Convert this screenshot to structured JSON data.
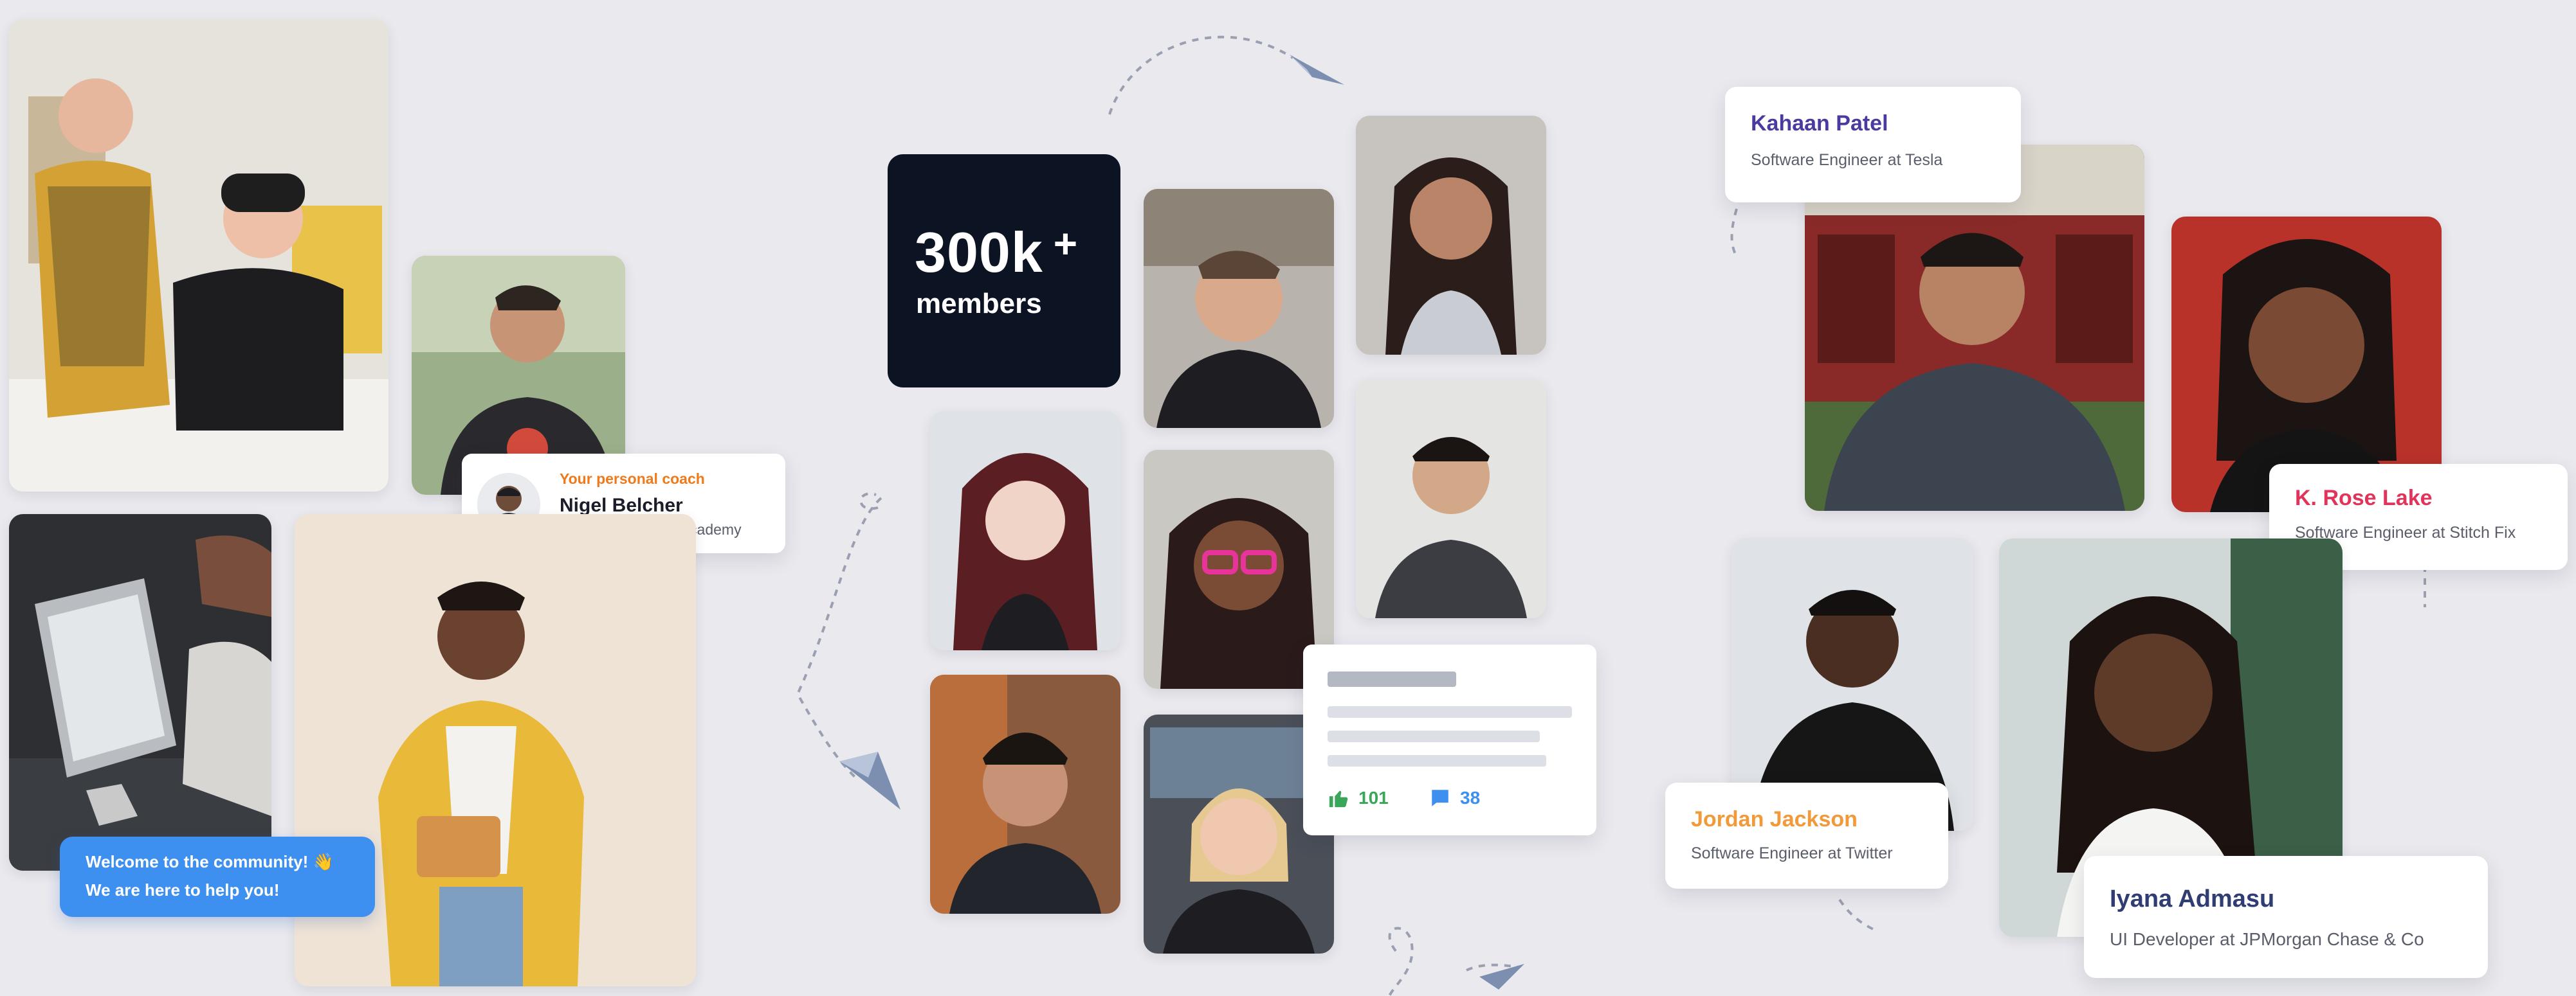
{
  "coach_card": {
    "label": "Your personal coach",
    "name": "Nigel Belcher",
    "role": "Student at Kenzie Academy"
  },
  "welcome_bubble": {
    "line1": "Welcome to the community! 👋",
    "line2": "We are here to help you!"
  },
  "stats": {
    "count": "300k",
    "plus": "+",
    "label": "members"
  },
  "post_card": {
    "likes": "101",
    "comments": "38"
  },
  "profiles": [
    {
      "name": "Kahaan Patel",
      "role": "Software Engineer at Tesla",
      "color": "#4b3aa0"
    },
    {
      "name": "K. Rose Lake",
      "role": "Software Engineer at Stitch Fix",
      "color": "#e2345a"
    },
    {
      "name": "Jordan Jackson",
      "role": "Software Engineer at Twitter",
      "color": "#f29a3a"
    },
    {
      "name": "Iyana Admasu",
      "role": "UI Developer at JPMorgan Chase & Co",
      "color": "#2f3d73"
    }
  ],
  "colors": {
    "coach_label": "#f07a1a",
    "bubble": "#3d8ff0",
    "like_green": "#3aa65a",
    "comment_blue": "#3d8ff0",
    "background": "#e9e9ee"
  },
  "icons": [
    "thumbs-up-icon",
    "comment-icon",
    "paper-plane-icon",
    "waving-hand-icon"
  ]
}
